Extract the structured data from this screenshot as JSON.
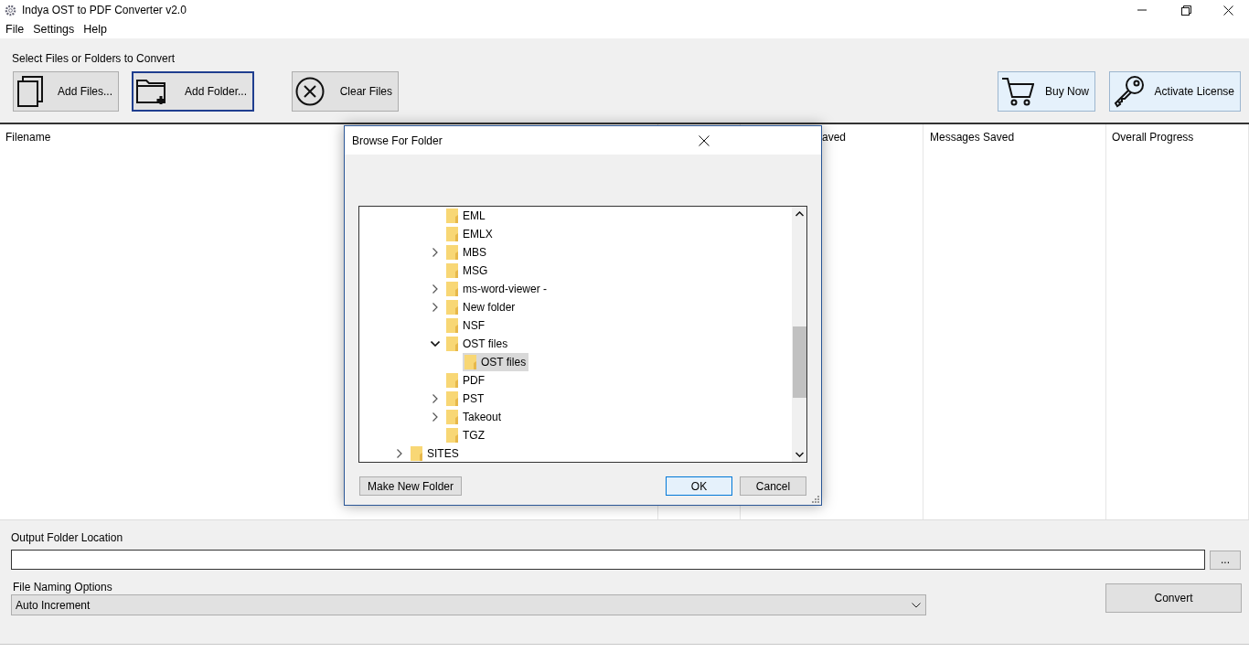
{
  "window": {
    "title": "Indya OST to PDF Converter v2.0"
  },
  "menu": [
    "File",
    "Settings",
    "Help"
  ],
  "toolbar": {
    "label": "Select Files or Folders to Convert",
    "buttons": [
      {
        "kind": "add-files",
        "label": "Add Files...",
        "focused": false
      },
      {
        "kind": "add-folder",
        "label": "Add Folder...",
        "focused": true
      },
      {
        "kind": "clear",
        "label": "Clear Files",
        "focused": false
      }
    ],
    "right_buttons": [
      {
        "kind": "buy",
        "label": "Buy Now"
      },
      {
        "kind": "license",
        "label": "Activate License"
      }
    ]
  },
  "table": {
    "columns": [
      "Filename",
      "aved",
      "Messages Saved",
      "Overall Progress"
    ]
  },
  "dialog": {
    "title": "Browse For Folder",
    "tree": [
      {
        "children": [
          {
            "label": "EML",
            "selected": false
          },
          {
            "label": "EMLX",
            "selected": false
          },
          {
            "label": "MBS",
            "expanded": false,
            "selected": false
          },
          {
            "label": "MSG",
            "selected": false
          },
          {
            "label": "ms-word-viewer -",
            "expanded": false,
            "selected": false
          },
          {
            "label": "New folder",
            "expanded": false,
            "selected": false
          },
          {
            "label": "NSF",
            "selected": false
          },
          {
            "label": "OST files",
            "expanded": true,
            "selected": false,
            "children": [
              {
                "label": "OST files",
                "selected": true
              }
            ]
          },
          {
            "label": "PDF",
            "selected": false
          },
          {
            "label": "PST",
            "expanded": false,
            "selected": false
          },
          {
            "label": "Takeout",
            "expanded": false,
            "selected": false
          },
          {
            "label": "TGZ",
            "selected": false
          }
        ]
      },
      {
        "label": "SITES",
        "expanded": false,
        "selected": false
      }
    ],
    "buttons": [
      {
        "label": "Make New Folder",
        "default": false
      },
      {
        "label": "OK",
        "default": true
      },
      {
        "label": "Cancel",
        "default": false
      }
    ]
  },
  "output": {
    "label": "Output Folder Location",
    "browse_button": "..."
  },
  "naming": {
    "label": "File Naming Options",
    "value": "Auto Increment"
  },
  "convert_button": "Convert"
}
